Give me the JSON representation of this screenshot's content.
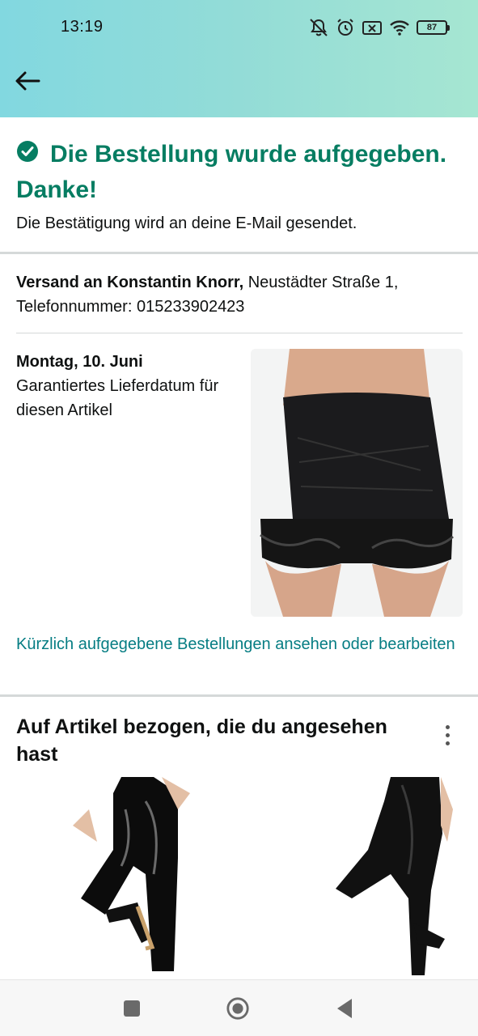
{
  "status_bar": {
    "time": "13:19",
    "battery": "87",
    "icons": [
      "mute-icon",
      "alarm-icon",
      "no-sim-icon",
      "wifi-icon",
      "battery-icon"
    ]
  },
  "header": {
    "back_icon": "arrow-left-icon",
    "gradient_colors": [
      "#82d8e0",
      "#a6e6d2"
    ]
  },
  "confirmation": {
    "icon": "check-circle-icon",
    "title": "Die Bestellung wurde aufgegeben. Danke!",
    "subtitle": "Die Bestätigung wird an deine E-Mail gesendet.",
    "color": "#067d62"
  },
  "shipping": {
    "label": "Versand an Konstantin Knorr,",
    "address": "Neustädter Straße 1, Telefonnummer: 015233902423"
  },
  "delivery": {
    "date": "Montag, 10. Juni",
    "note": "Garantiertes Lieferdatum für diesen Artikel"
  },
  "orders_link": {
    "text": "Kürzlich aufgegebene Bestellungen ansehen oder bearbeiten",
    "color": "#067d83"
  },
  "related": {
    "title": "Auf Artikel bezogen, die du angesehen hast",
    "menu_icon": "kebab-menu-icon"
  },
  "nav_bar": {
    "icons": [
      "recent-apps-icon",
      "home-icon",
      "back-triangle-icon"
    ]
  }
}
